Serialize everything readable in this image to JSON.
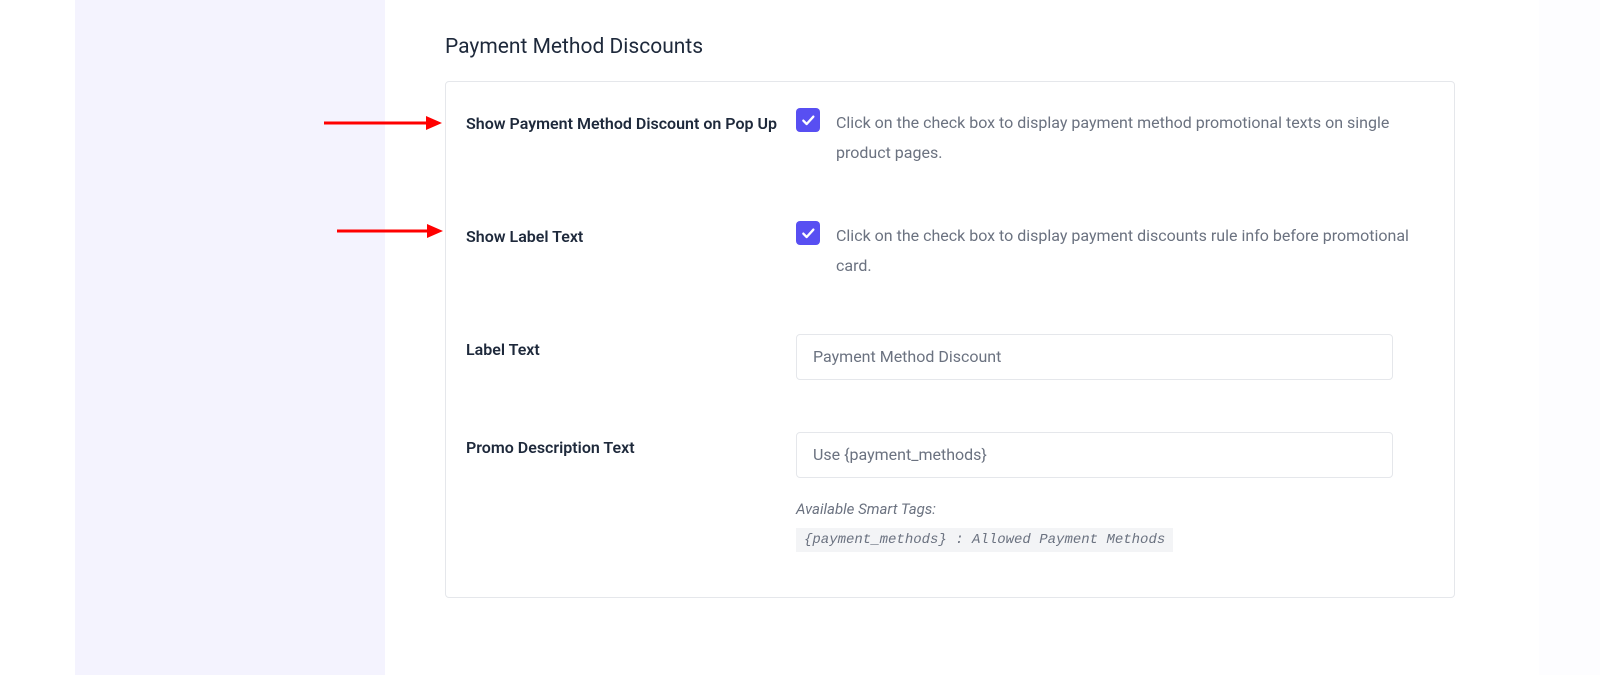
{
  "section": {
    "title": "Payment Method Discounts"
  },
  "settings": {
    "showPopup": {
      "label": "Show Payment Method Discount on Pop Up",
      "help": "Click on the check box to display payment method promotional texts on single product pages."
    },
    "showLabel": {
      "label": "Show Label Text",
      "help": "Click on the check box to display payment discounts rule info before promotional card."
    },
    "labelText": {
      "label": "Label Text",
      "value": "Payment Method Discount"
    },
    "promoDesc": {
      "label": "Promo Description Text",
      "value": "Use {payment_methods}",
      "smartTagsLabel": "Available Smart Tags:",
      "smartTag": "{payment_methods} : Allowed Payment Methods"
    }
  }
}
